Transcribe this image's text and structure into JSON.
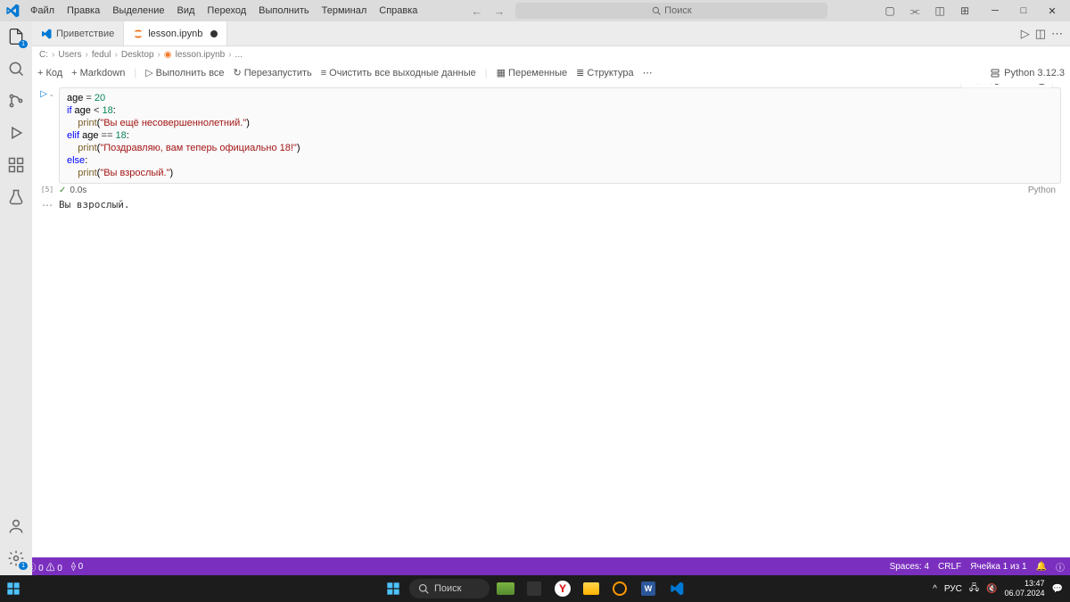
{
  "menu": [
    "Файл",
    "Правка",
    "Выделение",
    "Вид",
    "Переход",
    "Выполнить",
    "Терминал",
    "Справка"
  ],
  "search_placeholder": "Поиск",
  "tabs": [
    {
      "label": "Приветствие",
      "type": "welcome"
    },
    {
      "label": "lesson.ipynb",
      "type": "notebook",
      "active": true,
      "modified": true
    }
  ],
  "breadcrumb": [
    "C:",
    "Users",
    "fedul",
    "Desktop",
    "lesson.ipynb",
    "..."
  ],
  "nb_toolbar": {
    "code": "Код",
    "markdown": "Markdown",
    "run_all": "Выполнить все",
    "restart": "Перезапустить",
    "clear": "Очистить все выходные данные",
    "variables": "Переменные",
    "outline": "Структура",
    "kernel": "Python 3.12.3"
  },
  "cell": {
    "exec_count": "[5]",
    "exec_time": "0.0s",
    "language": "Python",
    "lines": [
      [
        {
          "t": "age ",
          "c": ""
        },
        {
          "t": "=",
          "c": "op"
        },
        {
          "t": " ",
          "c": ""
        },
        {
          "t": "20",
          "c": "num"
        }
      ],
      [
        {
          "t": "if",
          "c": "kw"
        },
        {
          "t": " age ",
          "c": ""
        },
        {
          "t": "<",
          "c": "op"
        },
        {
          "t": " ",
          "c": ""
        },
        {
          "t": "18",
          "c": "num"
        },
        {
          "t": ":",
          "c": ""
        }
      ],
      [
        {
          "t": "    ",
          "c": ""
        },
        {
          "t": "print",
          "c": "fn"
        },
        {
          "t": "(",
          "c": ""
        },
        {
          "t": "\"Вы ещё несовершеннолетний.\"",
          "c": "str"
        },
        {
          "t": ")",
          "c": ""
        }
      ],
      [
        {
          "t": "elif",
          "c": "kw"
        },
        {
          "t": " age ",
          "c": ""
        },
        {
          "t": "==",
          "c": "op"
        },
        {
          "t": " ",
          "c": ""
        },
        {
          "t": "18",
          "c": "num"
        },
        {
          "t": ":",
          "c": ""
        }
      ],
      [
        {
          "t": "    ",
          "c": ""
        },
        {
          "t": "print",
          "c": "fn"
        },
        {
          "t": "(",
          "c": ""
        },
        {
          "t": "\"Поздравляю, вам теперь официально 18!\"",
          "c": "str"
        },
        {
          "t": ")",
          "c": ""
        }
      ],
      [
        {
          "t": "else",
          "c": "kw"
        },
        {
          "t": ":",
          "c": ""
        }
      ],
      [
        {
          "t": "    ",
          "c": ""
        },
        {
          "t": "print",
          "c": "fn"
        },
        {
          "t": "(",
          "c": ""
        },
        {
          "t": "\"Вы взрослый.\"",
          "c": "str"
        },
        {
          "t": ")",
          "c": ""
        }
      ]
    ],
    "output": "Вы взрослый."
  },
  "status": {
    "errors": "0",
    "warnings": "0",
    "ports": "0",
    "spaces": "Spaces: 4",
    "eol": "CRLF",
    "cell_info": "Ячейка 1 из 1"
  },
  "taskbar": {
    "search": "Поиск",
    "lang": "РУС",
    "time": "13:47",
    "date": "06.07.2024"
  }
}
